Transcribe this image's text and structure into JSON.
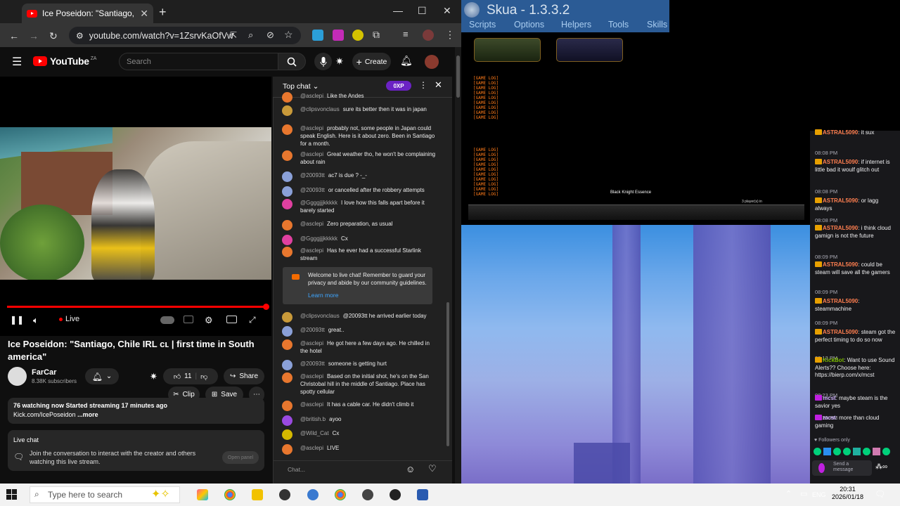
{
  "browser": {
    "tab_title": "Ice Poseidon: \"Santiago, Chile I",
    "url": "youtube.com/watch?v=1ZsrvKaOfVw",
    "new_tab": "+"
  },
  "youtube": {
    "logo": "YouTube",
    "region": "ZA",
    "search_placeholder": "Search",
    "create": "Create",
    "live": "Live",
    "title": "Ice Poseidon: \"Santiago, Chile IRL cʟ | first time in South america\"",
    "channel": "FarCar",
    "subscribers": "8.38K subscribers",
    "likes": "11",
    "share": "Share",
    "clip": "Clip",
    "save": "Save",
    "watching": "76 watching now  Started streaming 17 minutes ago",
    "desc_line2": "Kick.com/IcePoseidon",
    "more": "...more",
    "live_chat_title": "Live chat",
    "live_chat_text": "Join the conversation to interact with the creator and others watching this live stream.",
    "open_panel": "Open panel"
  },
  "chat": {
    "header": "Top chat",
    "xp": "0XP",
    "input_placeholder": "Chat...",
    "welcome": "Welcome to live chat! Remember to guard your privacy and abide by our community guidelines.",
    "learn_more": "Learn more",
    "messages": [
      {
        "user": "@asclepi",
        "text": "Like the Andes",
        "color": "#e8772e"
      },
      {
        "user": "@clipsvonclaus",
        "text": "sure its better then it was in japan",
        "color": "#c99a3a"
      },
      {
        "user": "@asclepi",
        "text": "probably not, some people in Japan could speak English. Here is it about zero. Been in Santiago for a month.",
        "color": "#e8772e"
      },
      {
        "user": "@asclepi",
        "text": "Great weather tho, he won't be complaining about rain",
        "color": "#e8772e"
      },
      {
        "user": "@20093tt",
        "text": "ac7 is due ? -_-",
        "color": "#8aa0d8"
      },
      {
        "user": "@20093tt",
        "text": "or cancelled after the robbery attempts",
        "color": "#8aa0d8"
      },
      {
        "user": "@Ggggjjjkkkkk",
        "text": "I love how this falls apart before it barely started",
        "color": "#e040a0"
      },
      {
        "user": "@asclepi",
        "text": "Zero preparation, as usual",
        "color": "#e8772e"
      },
      {
        "user": "@Ggggjjjkkkkk",
        "text": "Cx",
        "color": "#e040a0"
      },
      {
        "user": "@asclepi",
        "text": "Has he ever had a successful Starlink stream",
        "color": "#e8772e"
      },
      {
        "user": "@clipsvonclaus",
        "text": "@20093tt he arrived earlier today",
        "color": "#c99a3a"
      },
      {
        "user": "@20093tt",
        "text": "great..",
        "color": "#8aa0d8"
      },
      {
        "user": "@asclepi",
        "text": "He got here a few days ago. He chilled in the hotel",
        "color": "#e8772e"
      },
      {
        "user": "@20093tt",
        "text": "someone is getting hurt",
        "color": "#8aa0d8"
      },
      {
        "user": "@asclepi",
        "text": "Based on the initial shot, he's on the San Christobal hill in the middle of Santiago. Place has spotty cellular",
        "color": "#e8772e"
      },
      {
        "user": "@asclepi",
        "text": "It has a cable car. He didn't climb it",
        "color": "#e8772e"
      },
      {
        "user": "@british.b",
        "text": "ayoo",
        "color": "#9a4ae0"
      },
      {
        "user": "@Wild_Cat",
        "text": "Cx",
        "color": "#d4b800"
      },
      {
        "user": "@asclepi",
        "text": "LIVE",
        "color": "#e8772e"
      }
    ]
  },
  "skua": {
    "title": "Skua - 1.3.3.2",
    "menu": [
      "Scripts",
      "Options",
      "Helpers",
      "Tools",
      "Skills"
    ],
    "hud_boss": "Black Knight Essence",
    "players": "3 player(s) in"
  },
  "twitch": {
    "lines": [
      {
        "time": "",
        "user": "ASTRAL5090",
        "text": "it sux"
      },
      {
        "time": "08:08 PM",
        "user": "ASTRAL5090",
        "text": "if internet is little bad it woulf glitch out"
      },
      {
        "time": "08:08 PM",
        "user": "ASTRAL5090",
        "text": "or lagg always"
      },
      {
        "time": "08:08 PM",
        "user": "ASTRAL5090",
        "text": "i think cloud gamign is not the future"
      },
      {
        "time": "08:09 PM",
        "user": "ASTRAL5090",
        "text": "could be steam will save all the gamers"
      },
      {
        "time": "08:09 PM",
        "user": "ASTRAL5090",
        "text": "steammachine"
      },
      {
        "time": "08:09 PM",
        "user": "ASTRAL5090",
        "text": "steam got the perfect timing to do so now"
      },
      {
        "time": "08:13 PM",
        "user": "KickBot",
        "text": "Want to use Sound Alerts?? Choose here: https://bierp.com/x/mcst"
      },
      {
        "time": "08:23 PM",
        "user": "mcst",
        "text": "maybe steam is the savior yes"
      },
      {
        "time": "08:23 PM",
        "user": "mcst",
        "text": "more than cloud gaming"
      }
    ],
    "followers_only": "Followers only",
    "send": "Send a message"
  },
  "taskbar": {
    "search": "Type here to search",
    "lang": "ENG",
    "time": "20:31",
    "date": "2026/01/18"
  }
}
